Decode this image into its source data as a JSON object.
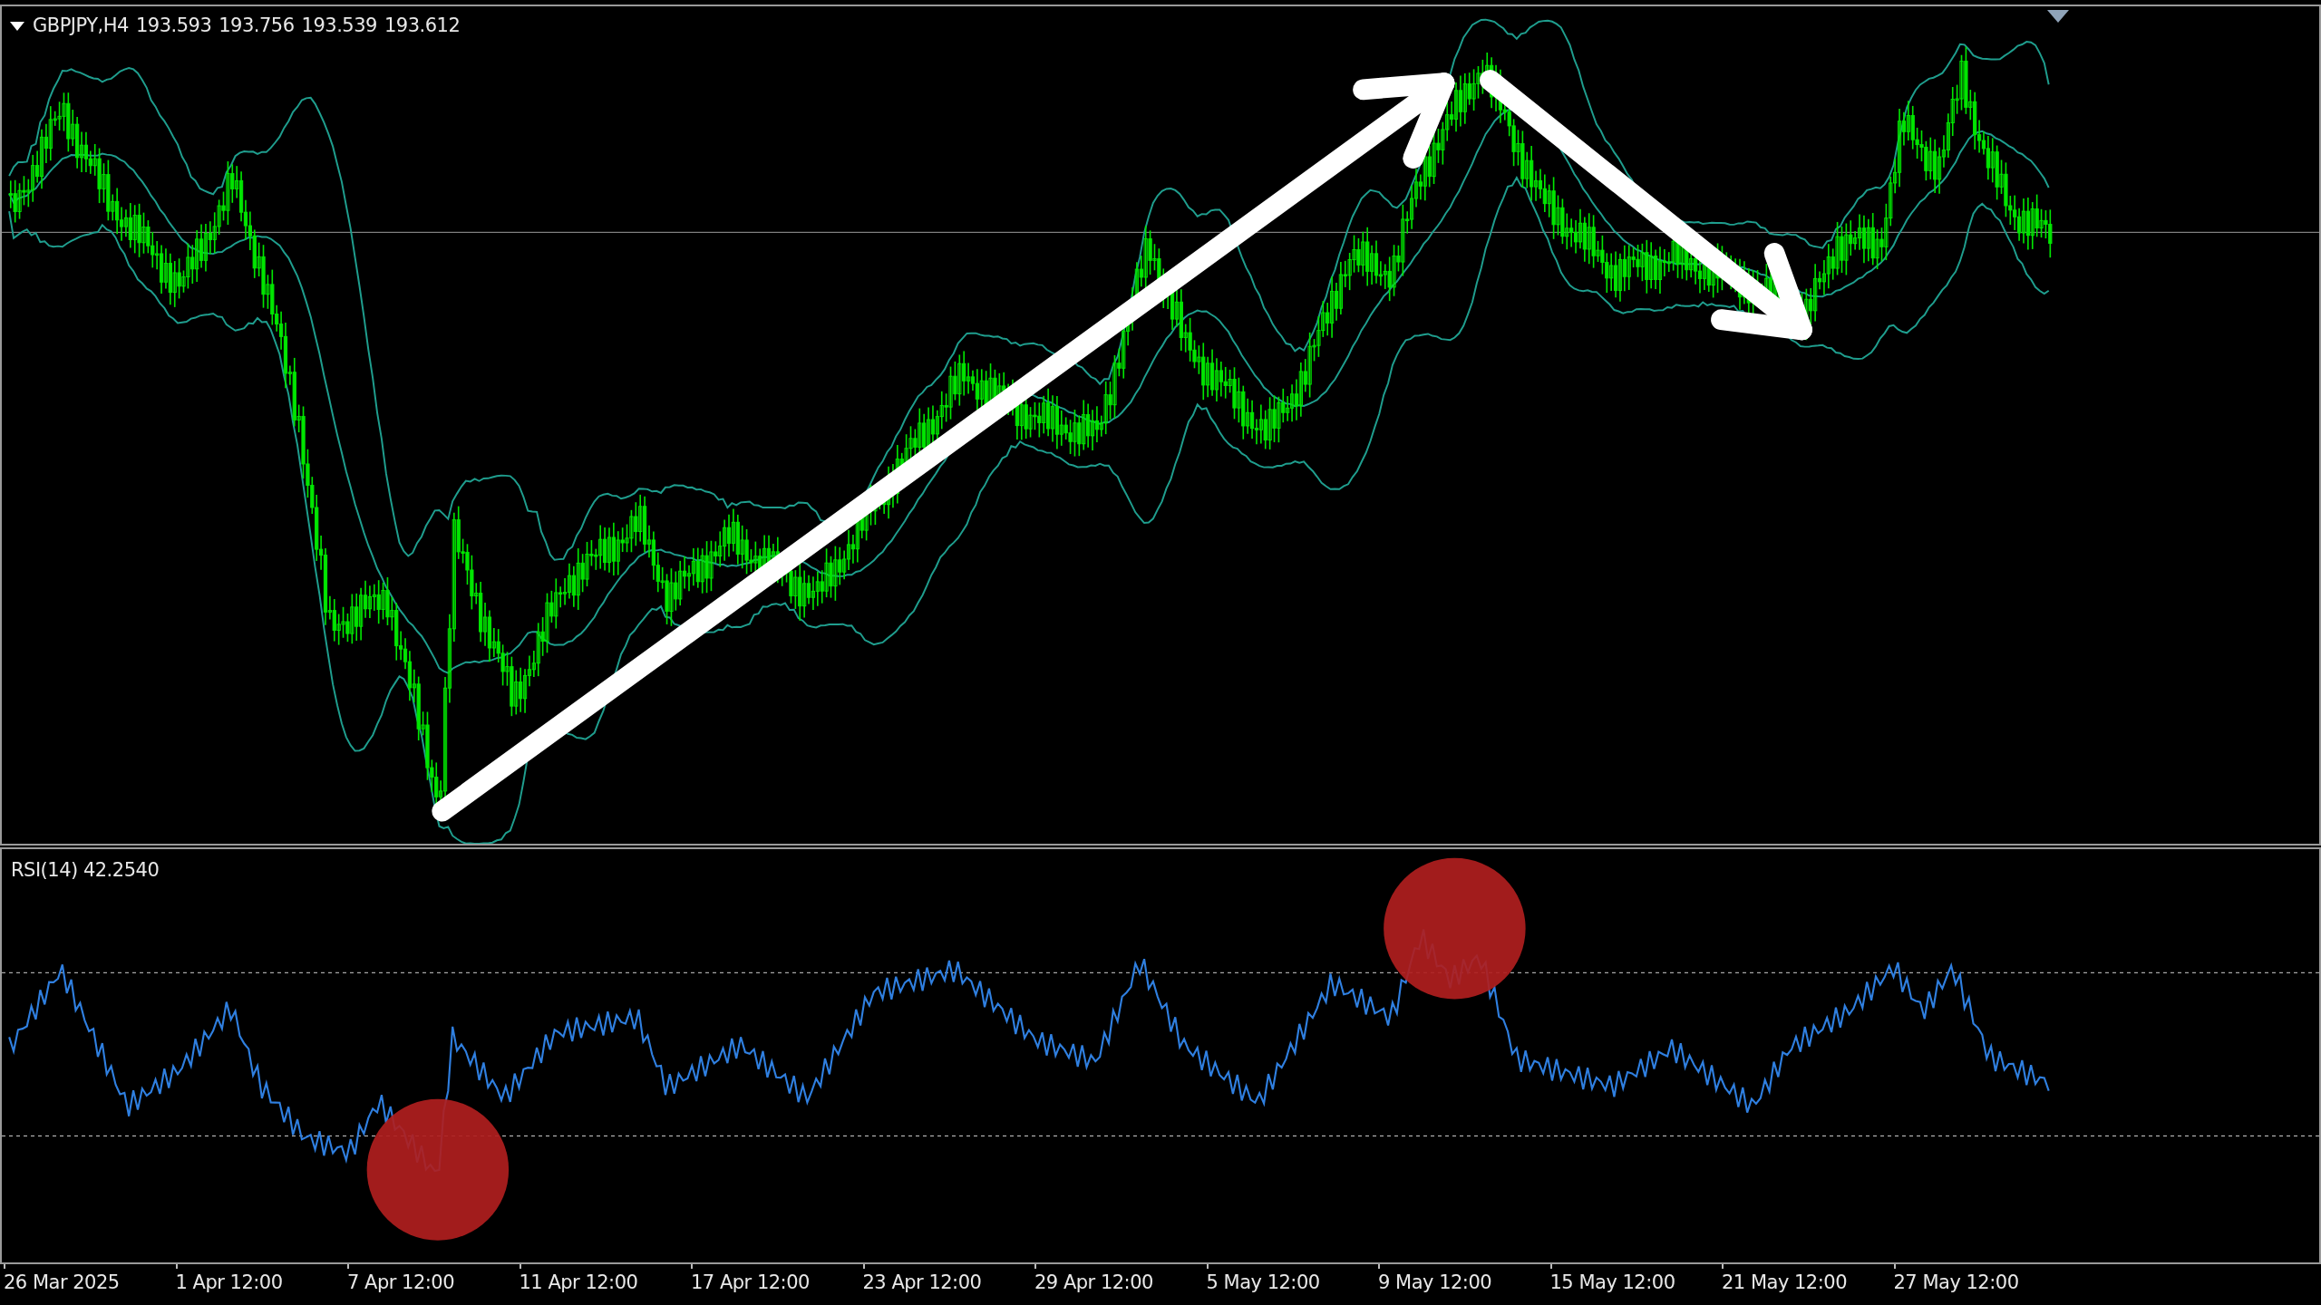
{
  "price_panel": {
    "symbol": "GBPJPY,H4",
    "quotes": [
      "193.593",
      "193.756",
      "193.539",
      "193.612"
    ]
  },
  "rsi_panel": {
    "label": "RSI(14) 42.2540"
  },
  "time_axis": [
    "26 Mar 2025",
    "1 Apr 12:00",
    "7 Apr 12:00",
    "11 Apr 12:00",
    "17 Apr 12:00",
    "23 Apr 12:00",
    "29 Apr 12:00",
    "5 May 12:00",
    "9 May 12:00",
    "15 May 12:00",
    "21 May 12:00",
    "27 May 12:00"
  ]
}
